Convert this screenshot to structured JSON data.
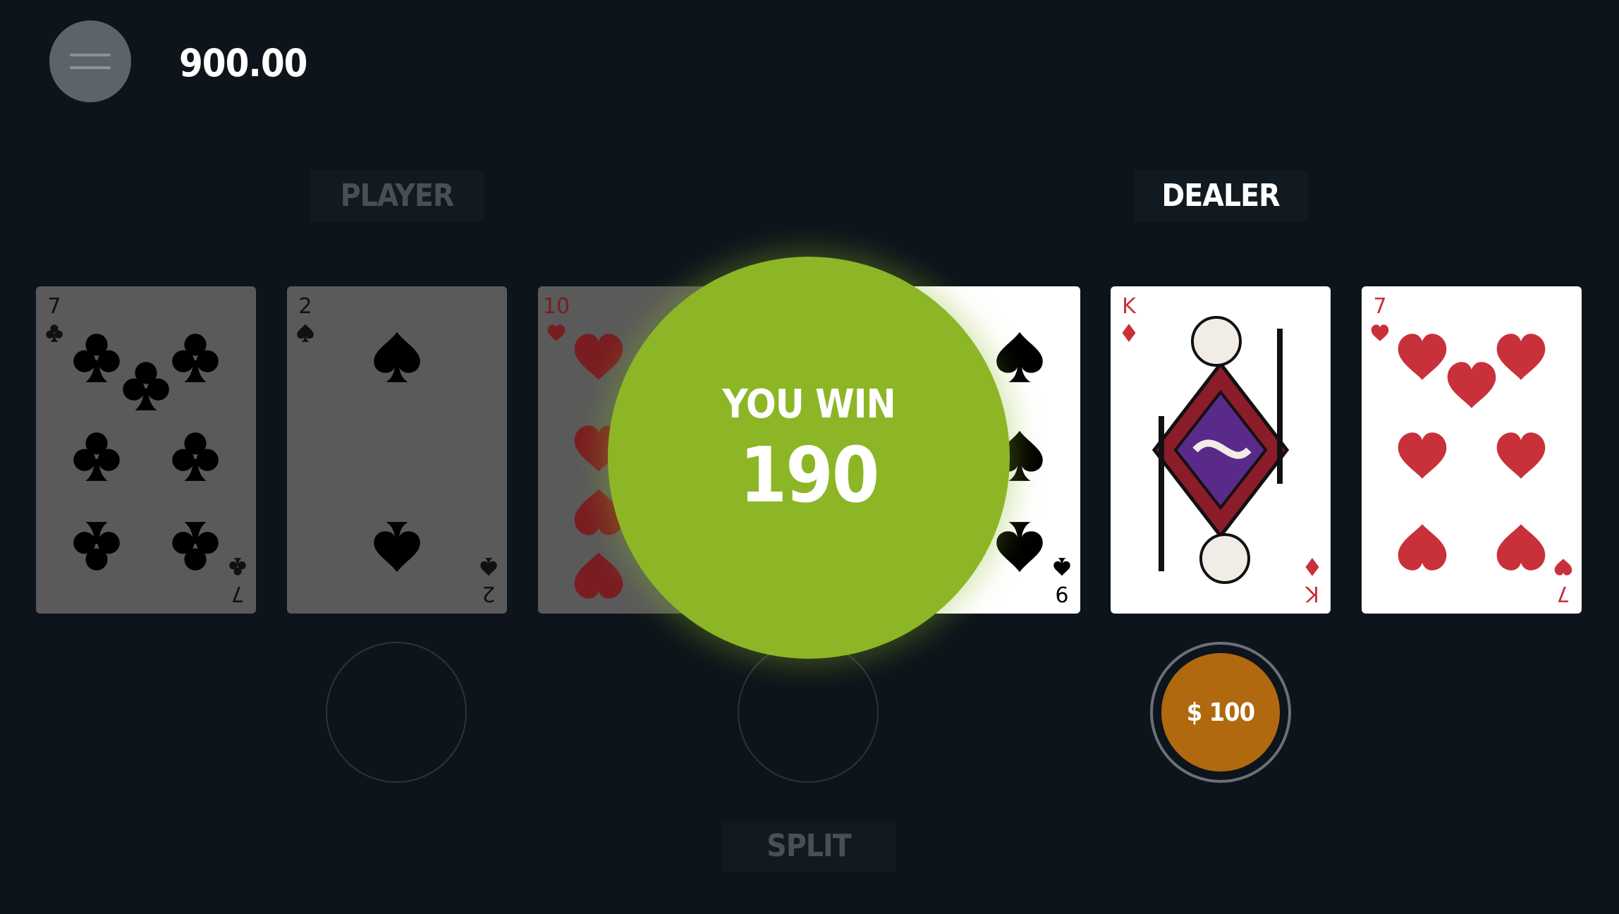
{
  "header": {
    "balance": "900.00"
  },
  "labels": {
    "player": "PLAYER",
    "dealer": "DEALER",
    "split": "SPLIT"
  },
  "result": {
    "title": "YOU WIN",
    "amount": "190"
  },
  "chip": {
    "label": "$ 100",
    "color": "#b0690e"
  },
  "colors": {
    "win": "#8db626",
    "background": "#0e141b",
    "heart": "#c8313a",
    "black": "#000000"
  },
  "cards": [
    {
      "rank": "7",
      "suit": "clubs",
      "state": "dimmed"
    },
    {
      "rank": "2",
      "suit": "spades",
      "state": "dimmed"
    },
    {
      "rank": "10",
      "suit": "hearts",
      "state": "dimmed"
    },
    {
      "rank": "9",
      "suit": "spades",
      "state": "normal"
    },
    {
      "rank": "K",
      "suit": "diamonds",
      "state": "normal"
    },
    {
      "rank": "7",
      "suit": "hearts",
      "state": "normal"
    }
  ]
}
